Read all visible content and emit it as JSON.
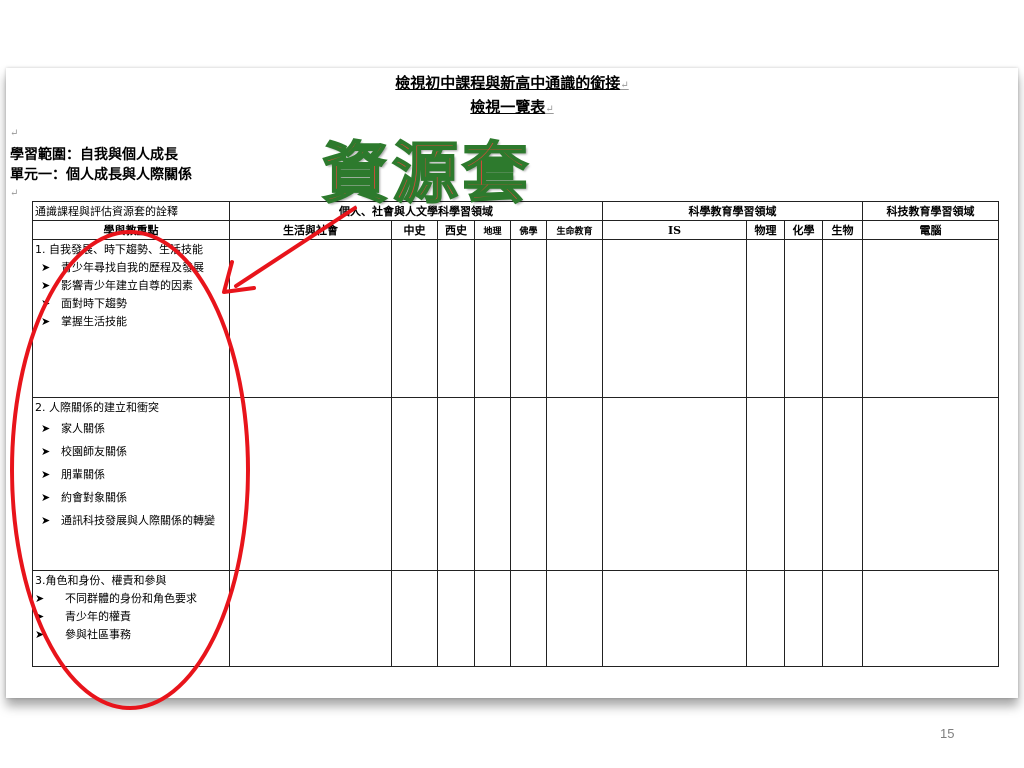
{
  "doc": {
    "title_line1": "檢視初中課程與新高中通識的銜接",
    "title_line2": "檢視一覽表",
    "scope_label": "學習範圍：自我與個人成長",
    "unit_label": "單元一：個人成長與人際關係"
  },
  "stamp_text": "資源套",
  "table": {
    "header_row1": {
      "desc": "通識課程與評估資源套的詮釋",
      "group1": "個人、社會與人文學科學習領域",
      "group2": "科學教育學習領域",
      "group3": "科技教育學習領域"
    },
    "header_row2": {
      "focus": "學與教重點",
      "cols": [
        "生活與社會",
        "中史",
        "西史",
        "地理",
        "佛學",
        "生命教育",
        "IS",
        "物理",
        "化學",
        "生物",
        "電腦"
      ]
    },
    "rows": [
      {
        "topic": "1.  自我發展、時下趨勢、生活技能",
        "items": [
          "青少年尋找自我的歷程及發展",
          "影響青少年建立自尊的因素",
          "面對時下趨勢",
          "掌握生活技能"
        ]
      },
      {
        "topic": "2.  人際關係的建立和衝突",
        "items": [
          "家人關係",
          "校園師友關係",
          "朋輩關係",
          "約會對象關係",
          "通訊科技發展與人際關係的轉變"
        ]
      },
      {
        "topic": "3.角色和身份、權責和參與",
        "items": [
          "不同群體的身份和角色要求",
          "青少年的權責",
          "參與社區事務"
        ]
      }
    ]
  },
  "page_number": "15",
  "colors": {
    "annotation": "#e8141b",
    "stamp_fill": "#d64a3a",
    "stamp_outline": "#2d7a2d"
  }
}
